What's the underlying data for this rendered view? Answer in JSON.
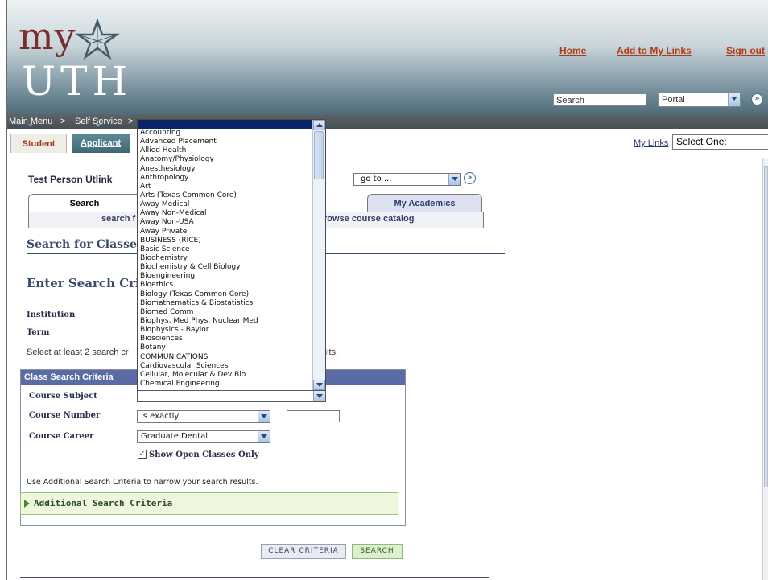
{
  "header": {
    "logo_top": "my",
    "logo_bottom": "UTH",
    "links": [
      "Home",
      "Add to My Links",
      "Sign out"
    ],
    "search_placeholder": "Search",
    "search_scope": "Portal"
  },
  "nav": {
    "main_menu": "Main Menu",
    "separator": ">",
    "self_service": "Self Service"
  },
  "tabs": {
    "student": "Student",
    "applicant": "Applicant"
  },
  "my_links": {
    "label": "My Links",
    "select_value": "Select One:"
  },
  "person_name": "Test Person Utlink",
  "goto_value": "go to ...",
  "content_tabs": {
    "search": "Search",
    "my_academics": "My Academics"
  },
  "subnav": {
    "left_text": "search f",
    "right_text": "rowse course catalog"
  },
  "headings": {
    "search_for_classes": "Search for Classes",
    "enter_search_criteria": "Enter Search Crite"
  },
  "fields": {
    "institution": "Institution",
    "term": "Term"
  },
  "hint": {
    "left": "Select at least 2 search cr",
    "right": "ults."
  },
  "criteria": {
    "title": "Class Search Criteria",
    "course_subject": "Course Subject",
    "course_number": "Course Number",
    "course_number_op": "is exactly",
    "course_career": "Course Career",
    "course_career_value": "Graduate Dental",
    "show_open": "Show Open Classes Only",
    "additional_hint": "Use Additional Search Criteria to narrow your search results.",
    "additional": "Additional Search Criteria"
  },
  "buttons": {
    "clear": "CLEAR CRITERIA",
    "search": "SEARCH"
  },
  "subject_options": [
    "Accounting",
    "Advanced Placement",
    "Allied Health",
    "Anatomy/Physiology",
    "Anesthesiology",
    "Anthropology",
    "Art",
    "Arts  (Texas Common Core)",
    "Away Medical",
    "Away Non-Medical",
    "Away Non-USA",
    "Away Private",
    "BUSINESS (RICE)",
    "Basic Science",
    "Biochemistry",
    "Biochemistry & Cell Biology",
    "Bioengineering",
    "Bioethics",
    "Biology (Texas Common Core)",
    "Biomathematics & Biostatistics",
    "Biomed Comm",
    "Biophys, Med Phys, Nuclear Med",
    "Biophysics - Baylor",
    "Biosciences",
    "Botany",
    "COMMUNICATIONS",
    "Cardiovascular Sciences",
    "Cellular, Molecular & Dev Bio",
    "Chemical Engineering"
  ]
}
